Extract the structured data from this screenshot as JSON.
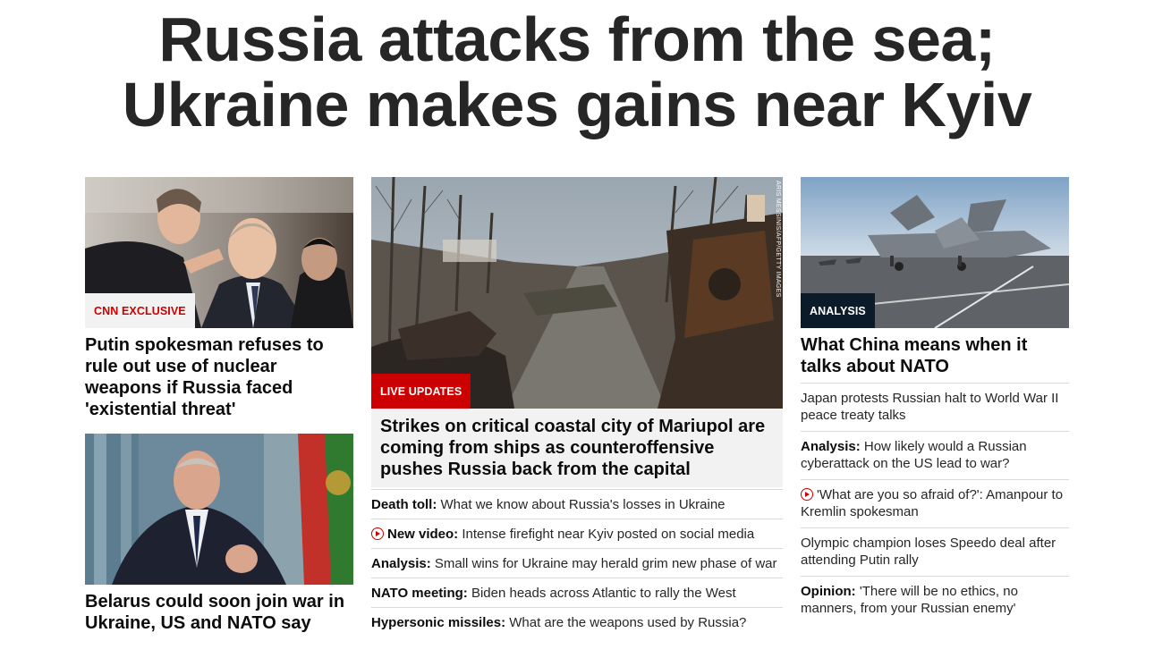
{
  "headline": {
    "line1": "Russia attacks from the sea;",
    "line2": "Ukraine makes gains near Kyiv"
  },
  "left": {
    "story1": {
      "image_icon": "photo-kremlin-officials",
      "label": "CNN EXCLUSIVE",
      "title": "Putin spokesman refuses to rule out use of nuclear weapons if Russia faced 'existential threat'"
    },
    "story2": {
      "image_icon": "photo-belarus-leader",
      "title": "Belarus could soon join war in Ukraine, US and NATO say"
    }
  },
  "middle": {
    "image_icon": "photo-destroyed-tanks-street",
    "credit": "ARIS MESSINIS/AFP/GETTY IMAGES",
    "label": "LIVE UPDATES",
    "title": "Strikes on critical coastal city of Mariupol are coming from ships as counteroffensive pushes Russia back from the capital",
    "links": [
      {
        "prefix": "Death toll:",
        "text": " What we know about Russia's losses in Ukraine",
        "video": false
      },
      {
        "prefix": "New video:",
        "text": " Intense firefight near Kyiv posted on social media",
        "video": true
      },
      {
        "prefix": "Analysis:",
        "text": " Small wins for Ukraine may herald grim new phase of war",
        "video": false
      },
      {
        "prefix": "NATO meeting:",
        "text": " Biden heads across Atlantic to rally the West",
        "video": false
      },
      {
        "prefix": "Hypersonic missiles:",
        "text": " What are the weapons used by Russia?",
        "video": false
      }
    ]
  },
  "right": {
    "image_icon": "photo-fighter-jet-carrier",
    "label": "ANALYSIS",
    "title": "What China means when it talks about NATO",
    "links": [
      {
        "prefix": "",
        "text": "Japan protests Russian halt to World War II peace treaty talks",
        "video": false
      },
      {
        "prefix": "Analysis:",
        "text": " How likely would a Russian cyberattack on the US lead to war?",
        "video": false
      },
      {
        "prefix": "",
        "text": "'What are you so afraid of?': Amanpour to Kremlin spokesman",
        "video": true
      },
      {
        "prefix": "",
        "text": "Olympic champion loses Speedo deal after attending Putin rally",
        "video": false
      },
      {
        "prefix": "Opinion:",
        "text": " 'There will be no ethics, no manners, from your Russian enemy'",
        "video": false
      }
    ]
  },
  "colors": {
    "accent_red": "#cc0000",
    "dark_label": "#0c1b2a",
    "panel_gray": "#f2f2f2"
  }
}
